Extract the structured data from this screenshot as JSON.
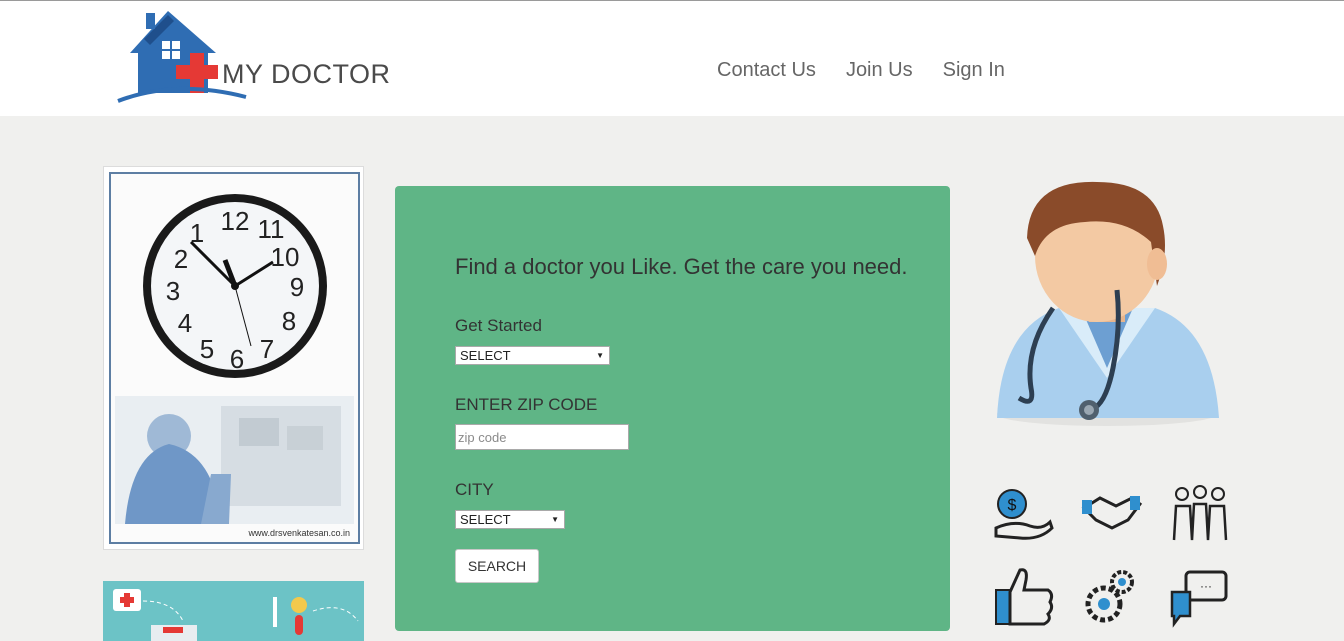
{
  "header": {
    "brand": "MY DOCTOR",
    "nav": [
      {
        "label": "Contact Us"
      },
      {
        "label": "Join Us"
      },
      {
        "label": "Sign In"
      }
    ]
  },
  "sidebar": {
    "photo_caption": "www.drsvenkatesan.co.in"
  },
  "search_panel": {
    "title": "Find a doctor you Like. Get the care you need.",
    "get_started_label": "Get Started",
    "get_started_value": "SELECT",
    "zip_label": "ENTER ZIP CODE",
    "zip_placeholder": "zip code",
    "city_label": "CITY",
    "city_value": "SELECT",
    "search_button": "SEARCH"
  },
  "colors": {
    "panel_bg": "#5fb586",
    "page_bg": "#f0f0ee",
    "logo_blue": "#2f6db3",
    "logo_red": "#e53935"
  },
  "icons": [
    "money-hand-icon",
    "handshake-icon",
    "people-group-icon",
    "thumbs-up-icon",
    "gears-icon",
    "chat-bubbles-icon"
  ]
}
